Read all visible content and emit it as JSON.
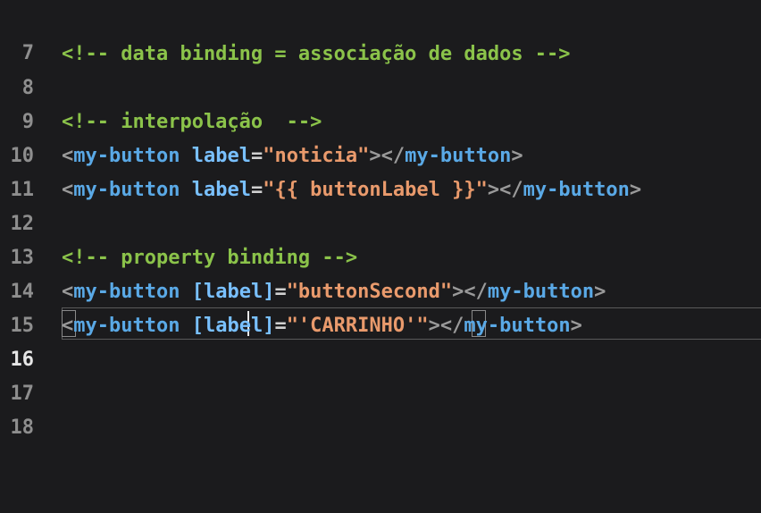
{
  "editor": {
    "lines": [
      {
        "number": "7",
        "text": ""
      },
      {
        "number": "8",
        "text": "<!-- data binding = associação de dados -->"
      },
      {
        "number": "9",
        "text": ""
      },
      {
        "number": "10",
        "text": "<!-- interpolação  -->"
      },
      {
        "number": "11",
        "parts": [
          "<",
          "my-button",
          " ",
          "label",
          "=",
          "\"noticia\"",
          "></",
          "my-button",
          ">"
        ]
      },
      {
        "number": "12",
        "parts": [
          "<",
          "my-button",
          " ",
          "label",
          "=",
          "\"{{ buttonLabel }}\"",
          "></",
          "my-button",
          ">"
        ]
      },
      {
        "number": "13",
        "text": ""
      },
      {
        "number": "14",
        "text": "<!-- property binding -->"
      },
      {
        "number": "15",
        "parts": [
          "<",
          "my-button",
          " ",
          "[label]",
          "=",
          "\"buttonSecond\"",
          "></",
          "my-button",
          ">"
        ]
      },
      {
        "number": "16",
        "parts": [
          "<",
          "my-button",
          " ",
          "[label]",
          "=",
          "\"'CARRINHO'\"",
          "></",
          "my-button",
          ">"
        ]
      },
      {
        "number": "17",
        "text": ""
      },
      {
        "number": "18",
        "text": ""
      }
    ]
  }
}
